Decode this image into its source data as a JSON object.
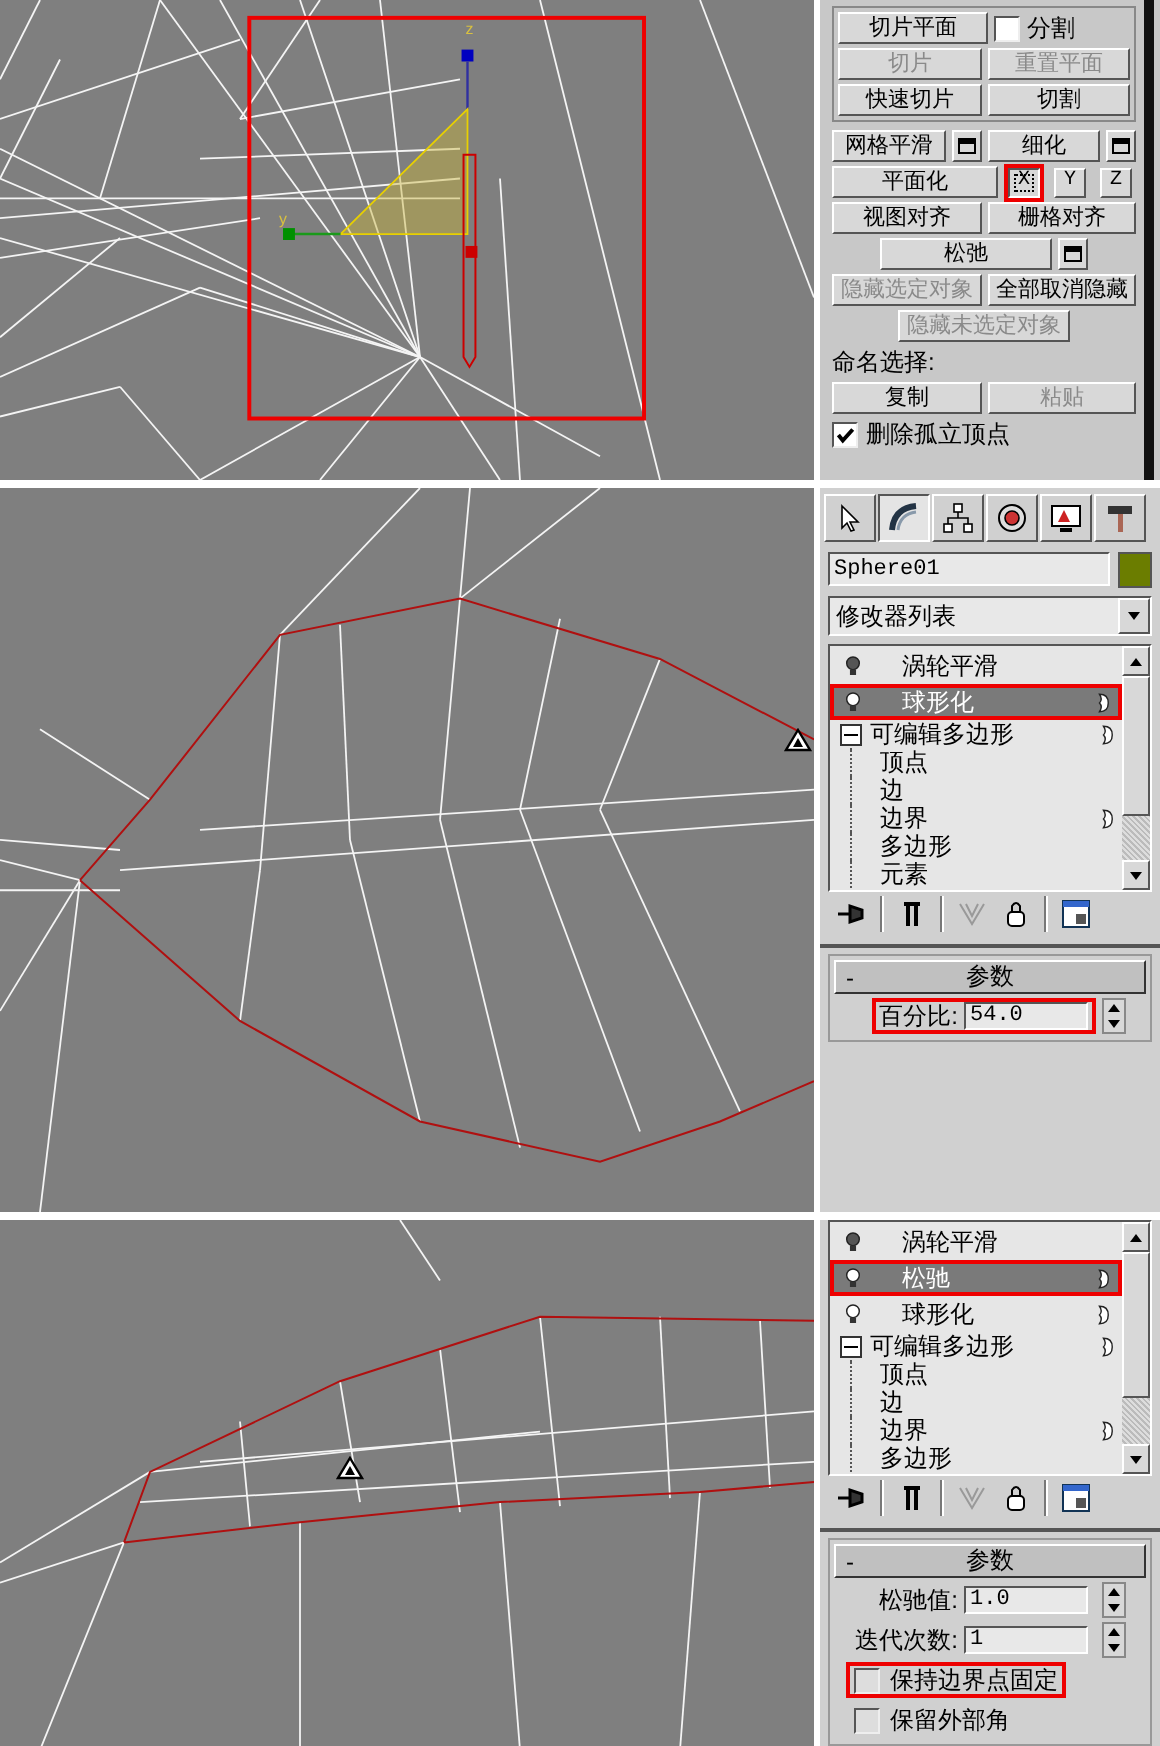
{
  "top": {
    "viewport": {
      "highlight_frame": true,
      "gizmo_labels": [
        "z",
        "y"
      ]
    },
    "panel": {
      "slice_group": [
        {
          "items": [
            {
              "kind": "button",
              "label": "切片平面",
              "disabled": false
            },
            {
              "kind": "checkbox",
              "label": "分割",
              "checked": false
            }
          ]
        },
        {
          "items": [
            {
              "kind": "button",
              "label": "切片",
              "disabled": true
            },
            {
              "kind": "button",
              "label": "重置平面",
              "disabled": true
            }
          ]
        },
        {
          "items": [
            {
              "kind": "button",
              "label": "快速切片",
              "disabled": false
            },
            {
              "kind": "button",
              "label": "切割",
              "disabled": false
            }
          ]
        }
      ],
      "rows": [
        {
          "items": [
            {
              "kind": "button",
              "label": "网格平滑",
              "disabled": false
            },
            {
              "kind": "box"
            },
            {
              "kind": "button",
              "label": "细化",
              "disabled": false
            },
            {
              "kind": "box"
            }
          ]
        },
        {
          "items": [
            {
              "kind": "button",
              "label": "平面化",
              "disabled": false
            },
            {
              "kind": "axis",
              "label": "X",
              "pressed": true,
              "highlighted": true
            },
            {
              "kind": "axis",
              "label": "Y",
              "pressed": false,
              "highlighted": false
            },
            {
              "kind": "axis",
              "label": "Z",
              "pressed": false,
              "highlighted": false
            }
          ]
        },
        {
          "items": [
            {
              "kind": "button",
              "label": "视图对齐",
              "disabled": false
            },
            {
              "kind": "button",
              "label": "栅格对齐",
              "disabled": false
            }
          ]
        },
        {
          "items": [
            {
              "kind": "button",
              "label": "松弛",
              "disabled": false
            },
            {
              "kind": "box"
            }
          ]
        },
        {
          "items": [
            {
              "kind": "button",
              "label": "隐藏选定对象",
              "disabled": true
            },
            {
              "kind": "button",
              "label": "全部取消隐藏",
              "disabled": false
            }
          ]
        },
        {
          "items": [
            {
              "kind": "button",
              "label": "隐藏未选定对象",
              "disabled": true
            }
          ]
        },
        {
          "items": [
            {
              "kind": "label",
              "label": "命名选择:"
            }
          ]
        },
        {
          "items": [
            {
              "kind": "button",
              "label": "复制",
              "disabled": false
            },
            {
              "kind": "button",
              "label": "粘贴",
              "disabled": true
            }
          ]
        },
        {
          "items": [
            {
              "kind": "checkbox",
              "label": "删除孤立顶点",
              "checked": true
            }
          ]
        }
      ]
    }
  },
  "middle": {
    "viewport": {
      "triangle_marker": true
    },
    "panel": {
      "command_tabs": [
        {
          "selected": false
        },
        {
          "selected": true
        },
        {
          "selected": false
        },
        {
          "selected": false
        },
        {
          "selected": false
        },
        {
          "selected": false
        }
      ],
      "object_name": "Sphere01",
      "modifier_list": "修改器列表",
      "stack": [
        {
          "label": "涡轮平滑",
          "enabled": false,
          "selected": false,
          "highlighted": false,
          "indicator": false
        },
        {
          "label": "球形化",
          "enabled": true,
          "selected": true,
          "highlighted": true,
          "indicator": true
        },
        {
          "label": "可编辑多边形",
          "expanded": true,
          "selected": false,
          "indicator": true,
          "children": [
            {
              "label": "顶点",
              "indicator": false
            },
            {
              "label": "边",
              "indicator": false
            },
            {
              "label": "边界",
              "indicator": true
            },
            {
              "label": "多边形",
              "indicator": false
            },
            {
              "label": "元素",
              "indicator": false
            }
          ]
        }
      ],
      "rollout": {
        "collapse": "-",
        "title": "参数",
        "fields": [
          {
            "label": "百分比:",
            "value": "54.0",
            "highlighted": true
          }
        ]
      }
    }
  },
  "bottom": {
    "viewport": {
      "triangle_marker": true
    },
    "panel": {
      "stack": [
        {
          "label": "涡轮平滑",
          "enabled": false,
          "selected": false,
          "highlighted": false,
          "indicator": false
        },
        {
          "label": "松驰",
          "enabled": true,
          "selected": true,
          "highlighted": true,
          "indicator": true
        },
        {
          "label": "球形化",
          "enabled": true,
          "selected": false,
          "highlighted": false,
          "indicator": true
        },
        {
          "label": "可编辑多边形",
          "expanded": true,
          "selected": false,
          "indicator": true,
          "children": [
            {
              "label": "顶点",
              "indicator": false
            },
            {
              "label": "边",
              "indicator": false
            },
            {
              "label": "边界",
              "indicator": true
            },
            {
              "label": "多边形",
              "indicator": false
            }
          ]
        }
      ],
      "rollout": {
        "collapse": "-",
        "title": "参数",
        "fields": [
          {
            "label": "松驰值:",
            "value": "1.0",
            "highlighted": false
          },
          {
            "label": "迭代次数:",
            "value": "1",
            "highlighted": false
          }
        ],
        "checkboxes": [
          {
            "label": "保持边界点固定",
            "checked": false,
            "highlighted": true
          },
          {
            "label": "保留外部角",
            "checked": false,
            "highlighted": false
          }
        ]
      }
    }
  }
}
